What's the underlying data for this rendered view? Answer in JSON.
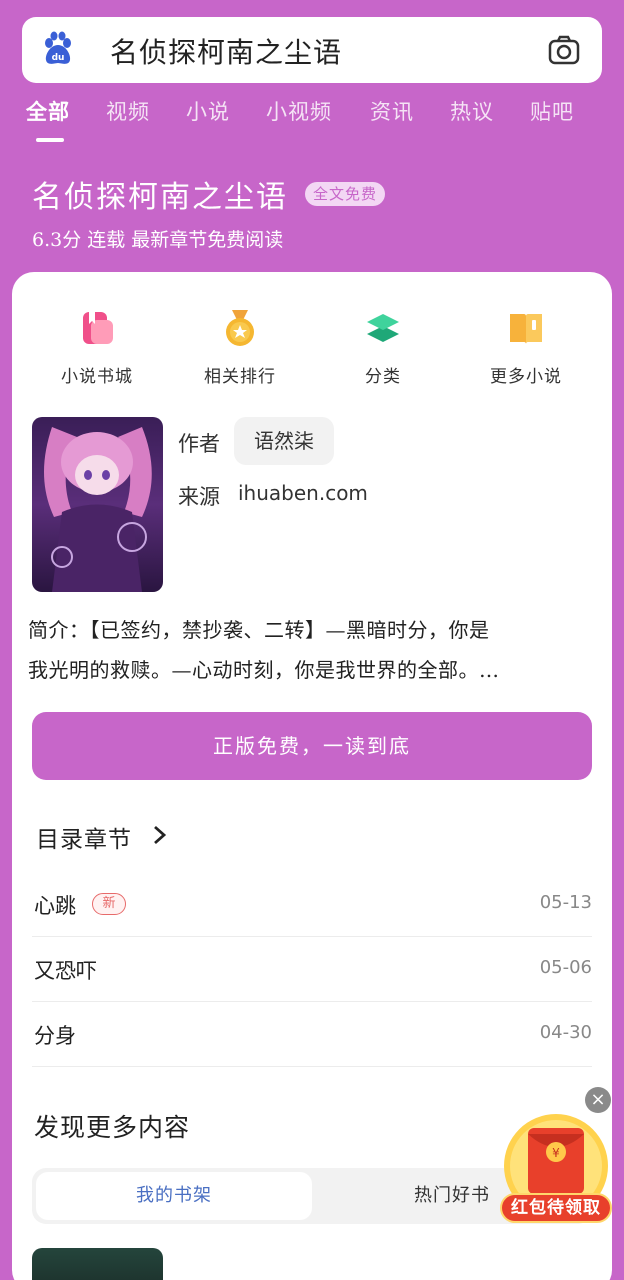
{
  "search": {
    "query": "名侦探柯南之尘语",
    "logo_icon": "baidu-paw-icon",
    "camera_icon": "camera-icon"
  },
  "tabs": [
    {
      "label": "全部",
      "active": true
    },
    {
      "label": "视频",
      "active": false
    },
    {
      "label": "小说",
      "active": false
    },
    {
      "label": "小视频",
      "active": false
    },
    {
      "label": "资讯",
      "active": false
    },
    {
      "label": "热议",
      "active": false
    },
    {
      "label": "贴吧",
      "active": false
    }
  ],
  "book": {
    "title": "名侦探柯南之尘语",
    "badge": "全文免费",
    "meta": "6.3分 连载 最新章节免费阅读",
    "author_label": "作者",
    "author": "语然柒",
    "source_label": "来源",
    "source": "ihuaben.com",
    "intro_line1": "简介：【已签约，禁抄袭、二转】—黑暗时分，你是",
    "intro_line2": "我光明的救赎。—心动时刻，你是我世界的全部。…",
    "read_button": "正版免费，一读到底"
  },
  "quick_links": [
    {
      "label": "小说书城",
      "icon": "bookstore-icon"
    },
    {
      "label": "相关排行",
      "icon": "medal-icon"
    },
    {
      "label": "分类",
      "icon": "layers-icon"
    },
    {
      "label": "更多小说",
      "icon": "open-book-icon"
    }
  ],
  "toc": {
    "heading": "目录章节",
    "chapters": [
      {
        "name": "心跳",
        "date": "05-13",
        "new_badge": "新"
      },
      {
        "name": "又恐吓",
        "date": "05-06"
      },
      {
        "name": "分身",
        "date": "04-30"
      }
    ]
  },
  "discover": {
    "heading": "发现更多内容",
    "tabs": [
      "我的书架",
      "热门好书"
    ]
  },
  "red_packet": {
    "label": "红包待领取",
    "close": "×"
  },
  "colors": {
    "brand": "#c766c9",
    "accent_blue": "#4a6fc2",
    "new_badge": "#e76a6a"
  }
}
